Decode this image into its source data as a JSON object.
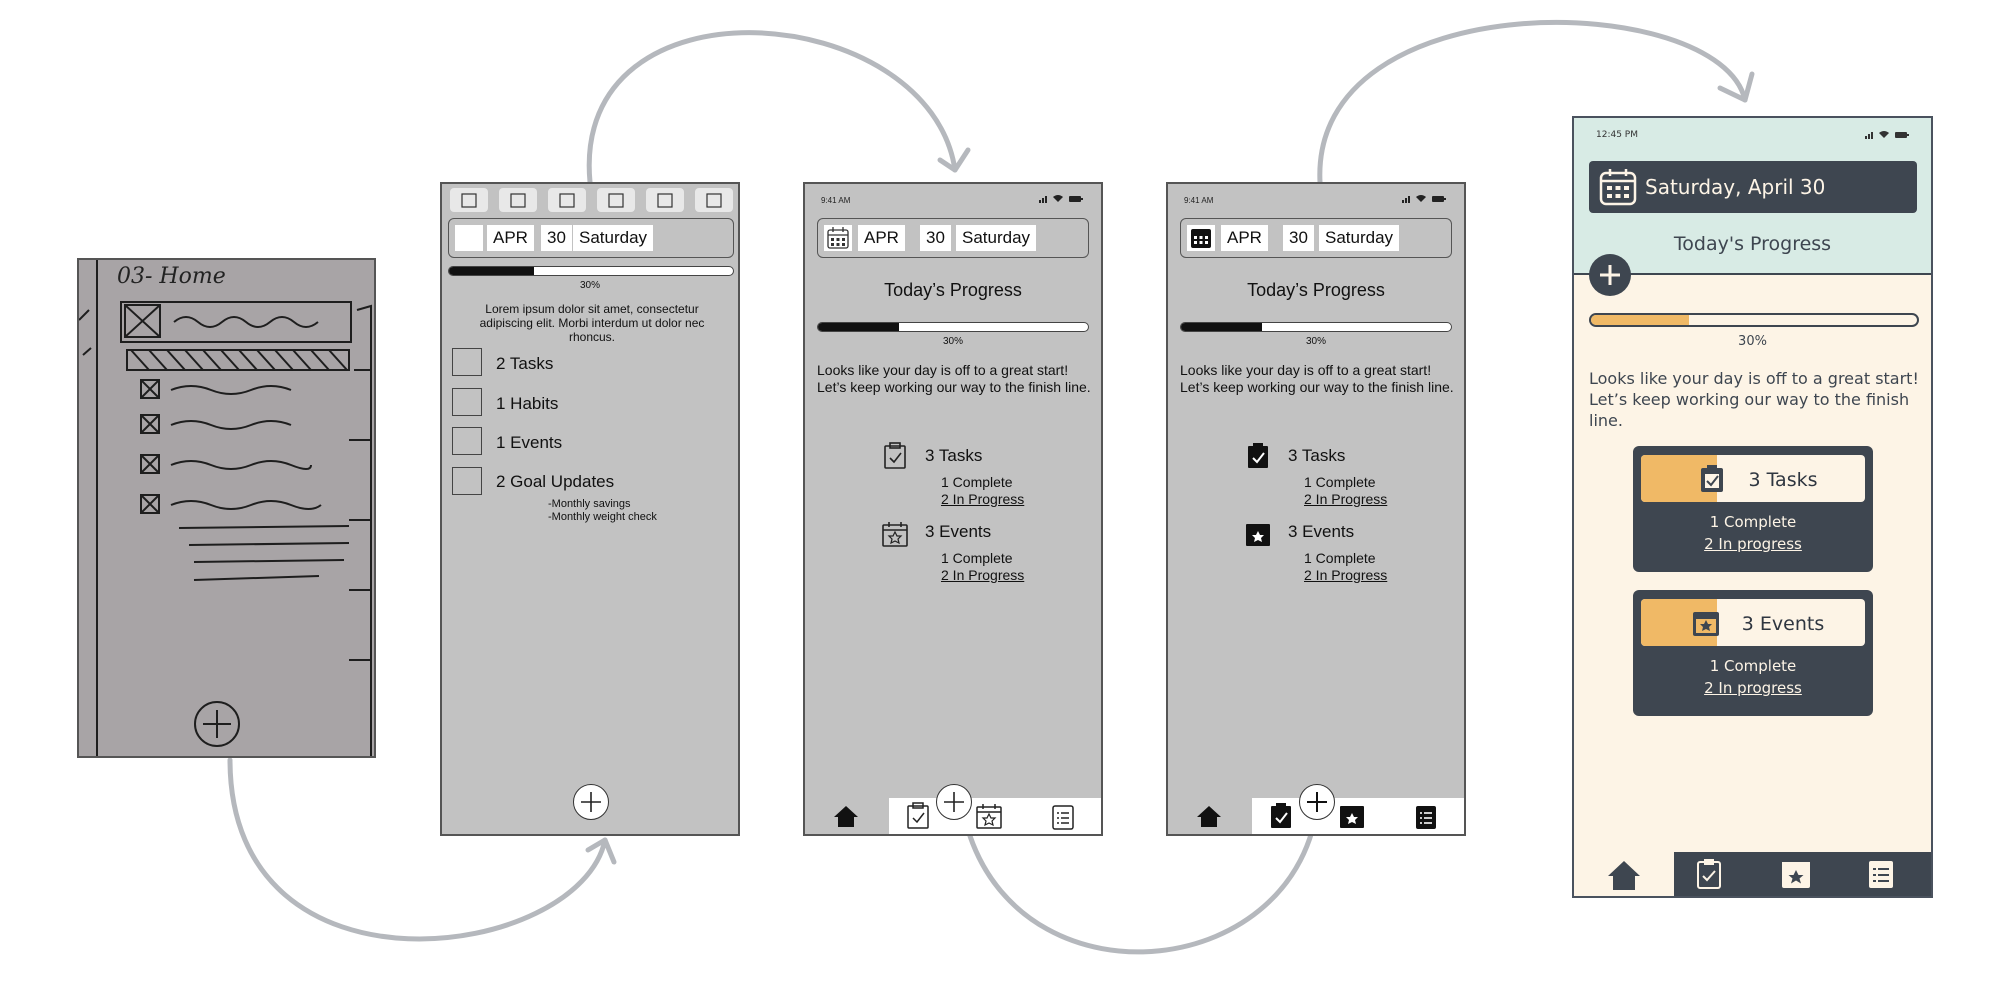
{
  "sketch": {
    "title": "03- Home"
  },
  "screen_lofi": {
    "date": {
      "month": "APR",
      "day": "30",
      "weekday": "Saturday"
    },
    "progress": {
      "percent_label": "30%",
      "fraction": 0.3
    },
    "lorem": "Lorem ipsum dolor sit amet, consectetur adipiscing elit. Morbi interdum ut dolor nec rhoncus.",
    "items": [
      {
        "label": "2 Tasks"
      },
      {
        "label": "1 Habits"
      },
      {
        "label": "1 Events"
      },
      {
        "label": "2 Goal Updates"
      }
    ],
    "goal_details": [
      "-Monthly savings",
      "-Monthly weight check"
    ]
  },
  "screen_mid": {
    "status_time": "9:41 AM",
    "date": {
      "month": "APR",
      "day": "30",
      "weekday": "Saturday"
    },
    "progress_title": "Today’s Progress",
    "progress": {
      "percent_label": "30%",
      "fraction": 0.3
    },
    "message": "Looks like your day is off to a great start! Let’s keep working our way to the finish line.",
    "tasks": {
      "title": "3 Tasks",
      "complete": "1 Complete",
      "in_progress": "2 In Progress"
    },
    "events": {
      "title": "3 Events",
      "complete": "1 Complete",
      "in_progress": "2 In Progress"
    }
  },
  "screen_hifi": {
    "status_time": "12:45 PM",
    "date_label": "Saturday, April 30",
    "progress_title": "Today's Progress",
    "progress": {
      "percent_label": "30%",
      "fraction": 0.3
    },
    "message": "Looks like your day is off to a great start! Let’s keep working our way to the finish line.",
    "tasks": {
      "title": "3 Tasks",
      "complete": "1 Complete",
      "in_progress": "2 In progress"
    },
    "events": {
      "title": "3 Events",
      "complete": "1 Complete",
      "in_progress": "2 In progress"
    },
    "colors": {
      "mint": "#d8ebe5",
      "cream": "#fdf4e6",
      "slate": "#3e4650",
      "orange": "#f0b966"
    }
  },
  "icons": [
    "plus-icon",
    "calendar-icon",
    "clipboard-check-icon",
    "calendar-star-icon",
    "list-icon",
    "home-icon",
    "signal-icon",
    "wifi-icon",
    "battery-icon"
  ]
}
